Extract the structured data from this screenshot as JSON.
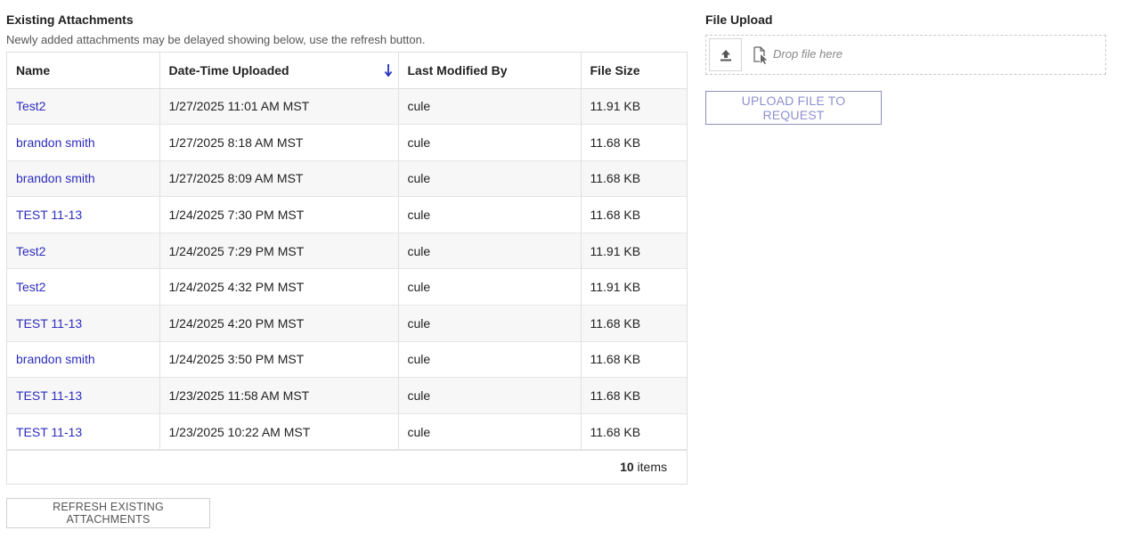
{
  "attachments": {
    "title": "Existing Attachments",
    "subtitle": "Newly added attachments may be delayed showing below, use the refresh button.",
    "columns": [
      "Name",
      "Date-Time Uploaded",
      "Last Modified By",
      "File Size"
    ],
    "sort": {
      "column": "Date-Time Uploaded",
      "direction": "descending",
      "icon": "arrow-down-icon"
    },
    "rows": [
      {
        "name": "Test2",
        "uploaded": "1/27/2025 11:01 AM MST",
        "modified_by": "cule",
        "size": "11.91 KB"
      },
      {
        "name": "brandon smith",
        "uploaded": "1/27/2025 8:18 AM MST",
        "modified_by": "cule",
        "size": "11.68 KB"
      },
      {
        "name": "brandon smith",
        "uploaded": "1/27/2025 8:09 AM MST",
        "modified_by": "cule",
        "size": "11.68 KB"
      },
      {
        "name": "TEST 11-13",
        "uploaded": "1/24/2025 7:30 PM MST",
        "modified_by": "cule",
        "size": "11.68 KB"
      },
      {
        "name": "Test2",
        "uploaded": "1/24/2025 7:29 PM MST",
        "modified_by": "cule",
        "size": "11.91 KB"
      },
      {
        "name": "Test2",
        "uploaded": "1/24/2025 4:32 PM MST",
        "modified_by": "cule",
        "size": "11.91 KB"
      },
      {
        "name": "TEST 11-13",
        "uploaded": "1/24/2025 4:20 PM MST",
        "modified_by": "cule",
        "size": "11.68 KB"
      },
      {
        "name": "brandon smith",
        "uploaded": "1/24/2025 3:50 PM MST",
        "modified_by": "cule",
        "size": "11.68 KB"
      },
      {
        "name": "TEST 11-13",
        "uploaded": "1/23/2025 11:58 AM MST",
        "modified_by": "cule",
        "size": "11.68 KB"
      },
      {
        "name": "TEST 11-13",
        "uploaded": "1/23/2025 10:22 AM MST",
        "modified_by": "cule",
        "size": "11.68 KB"
      }
    ],
    "footer": {
      "count": "10",
      "label": "items"
    },
    "refresh_label": "REFRESH EXISTING ATTACHMENTS"
  },
  "upload": {
    "title": "File Upload",
    "drop_placeholder": "Drop file here",
    "upload_icon": "upload-icon",
    "drop_icon": "file-cursor-icon",
    "submit_label": "UPLOAD FILE TO REQUEST"
  },
  "colors": {
    "link": "#2c2cbe",
    "sort_arrow": "#1f2fbf",
    "upload_button_text": "#8f8fd0"
  }
}
